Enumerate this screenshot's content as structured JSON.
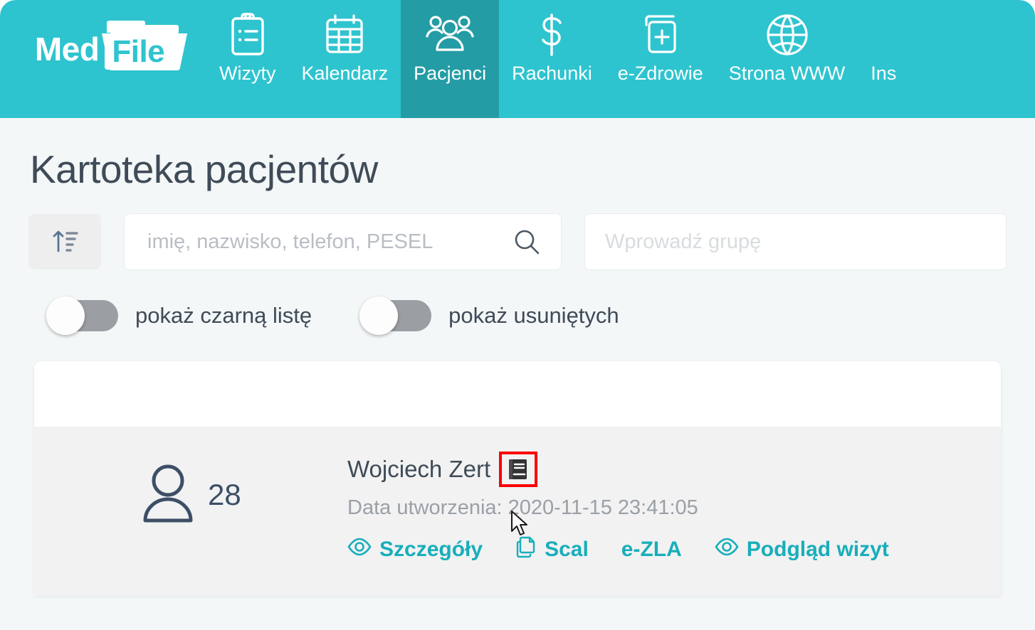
{
  "brand": {
    "med": "Med",
    "file": "File"
  },
  "nav": {
    "items": [
      {
        "label": "Wizyty",
        "icon": "clipboard-list-icon",
        "active": false
      },
      {
        "label": "Kalendarz",
        "icon": "calendar-icon",
        "active": false
      },
      {
        "label": "Pacjenci",
        "icon": "users-icon",
        "active": true
      },
      {
        "label": "Rachunki",
        "icon": "dollar-icon",
        "active": false
      },
      {
        "label": "e-Zdrowie",
        "icon": "health-card-icon",
        "active": false
      },
      {
        "label": "Strona WWW",
        "icon": "globe-icon",
        "active": false
      },
      {
        "label": "Ins",
        "icon": "none",
        "active": false
      }
    ]
  },
  "page": {
    "title": "Kartoteka pacjentów"
  },
  "filters": {
    "sort_icon": "sort-ascending-icon",
    "search": {
      "placeholder": "imię, nazwisko, telefon, PESEL",
      "value": "",
      "icon": "search-icon"
    },
    "group": {
      "placeholder": "Wprowadź grupę",
      "value": ""
    },
    "toggles": [
      {
        "label": "pokaż czarną listę",
        "on": false
      },
      {
        "label": "pokaż usuniętych",
        "on": false
      }
    ]
  },
  "patients": [
    {
      "avatar_icon": "person-icon",
      "age": "28",
      "name": "Wojciech Zert",
      "note_icon": "book-icon",
      "date": "Data utworzenia: 2020-11-15 23:41:05",
      "actions": [
        {
          "label": "Szczegóły",
          "icon": "eye-icon"
        },
        {
          "label": "Scal",
          "icon": "copy-icon"
        },
        {
          "label": "e-ZLA",
          "icon": "none"
        },
        {
          "label": "Podgląd wizyt",
          "icon": "eye-icon"
        }
      ]
    }
  ],
  "colors": {
    "brand_teal": "#2ec4cf",
    "active_tab_teal": "#249ca5",
    "link_teal": "#18aebb",
    "highlight_red": "#fb0000",
    "text_dark": "#3f4b57",
    "page_bg": "#f4f7f8"
  }
}
